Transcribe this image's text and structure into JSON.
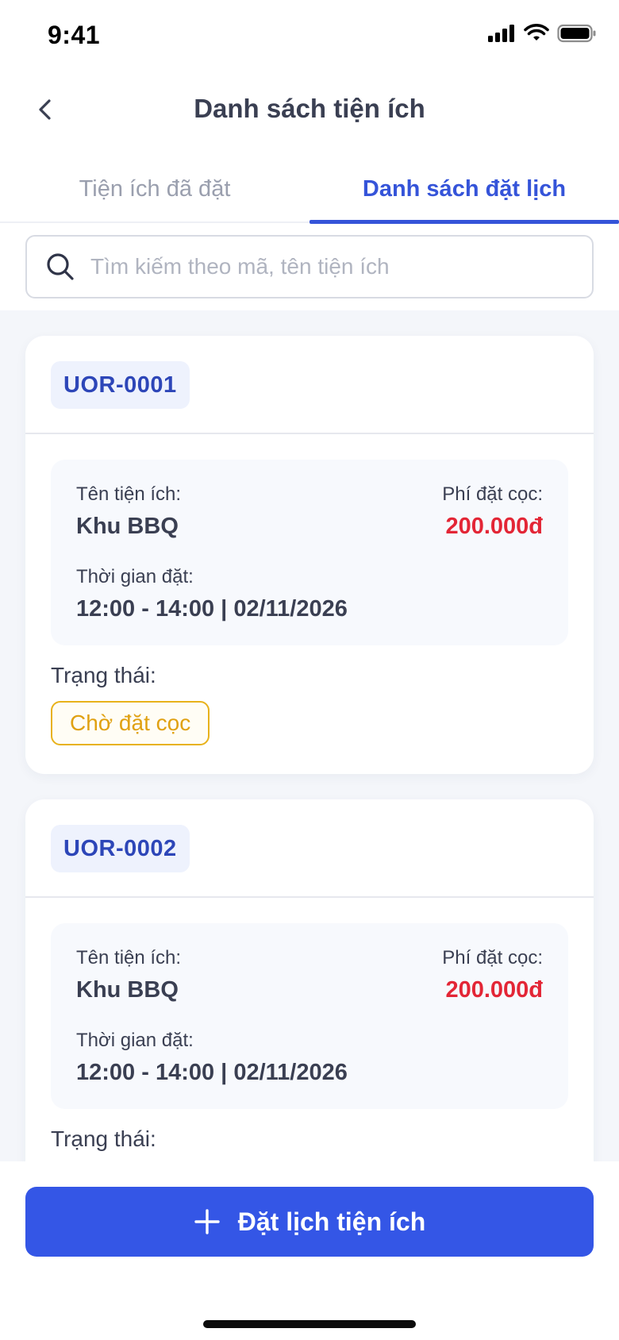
{
  "status_bar": {
    "time": "9:41"
  },
  "header": {
    "title": "Danh sách tiện ích"
  },
  "tabs": [
    {
      "label": "Tiện ích đã đặt",
      "active": false
    },
    {
      "label": "Danh sách đặt lịch",
      "active": true
    }
  ],
  "search": {
    "placeholder": "Tìm kiếm theo mã, tên tiện ích",
    "value": ""
  },
  "bookings": [
    {
      "code": "UOR-0001",
      "name_label": "Tên tiện ích:",
      "name": "Khu BBQ",
      "fee_label": "Phí đặt cọc:",
      "fee": "200.000đ",
      "time_label": "Thời gian đặt:",
      "time": "12:00 - 14:00 | 02/11/2026",
      "status_label": "Trạng thái:",
      "status": "Chờ đặt cọc"
    },
    {
      "code": "UOR-0002",
      "name_label": "Tên tiện ích:",
      "name": "Khu BBQ",
      "fee_label": "Phí đặt cọc:",
      "fee": "200.000đ",
      "time_label": "Thời gian đặt:",
      "time": "12:00 - 14:00 | 02/11/2026",
      "status_label": "Trạng thái:"
    }
  ],
  "footer": {
    "cta_label": "Đặt lịch tiện ích"
  },
  "colors": {
    "primary": "#3456e6",
    "tab_active": "#3554d9",
    "fee": "#e32636",
    "status_pending": "#e8b21b",
    "code_text": "#2d46b8",
    "list_background": "#f4f6fa"
  },
  "icons": {
    "back": "chevron-left-icon",
    "search": "search-icon",
    "add": "plus-icon",
    "signal": "signal-icon",
    "wifi": "wifi-icon",
    "battery": "battery-icon"
  }
}
